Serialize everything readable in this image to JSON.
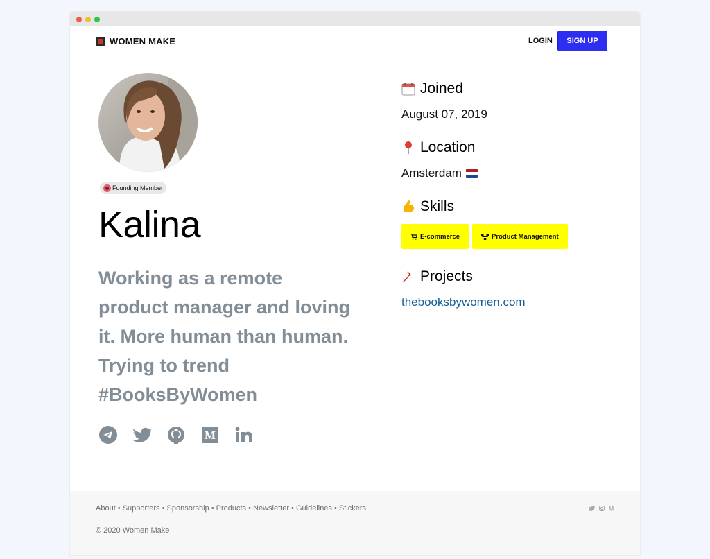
{
  "brand": {
    "name": "WOMEN MAKE"
  },
  "nav": {
    "login": "LOGIN",
    "signup": "SIGN UP"
  },
  "profile": {
    "badge": "Founding Member",
    "name": "Kalina",
    "bio": "Working as a remote product manager and loving it. More human than human. Trying to trend #BooksByWomen",
    "socials": [
      "telegram-icon",
      "twitter-icon",
      "github-icon",
      "medium-icon",
      "linkedin-icon"
    ]
  },
  "joined": {
    "title": "Joined",
    "value": "August 07, 2019"
  },
  "location": {
    "title": "Location",
    "value": "Amsterdam"
  },
  "skills": {
    "title": "Skills",
    "items": [
      {
        "label": "E-commerce",
        "icon": "cart-icon"
      },
      {
        "label": "Product Management",
        "icon": "sitemap-icon"
      }
    ]
  },
  "projects": {
    "title": "Projects",
    "items": [
      "thebooksbywomen.com"
    ]
  },
  "footer": {
    "links": [
      "About",
      "Supporters",
      "Sponsorship",
      "Products",
      "Newsletter",
      "Guidelines",
      "Stickers"
    ],
    "copyright": "© 2020 Women Make"
  },
  "colors": {
    "accent": "#2e2ef0",
    "skill_bg": "#ffff00",
    "bio_text": "#838d96",
    "link": "#135e96"
  }
}
